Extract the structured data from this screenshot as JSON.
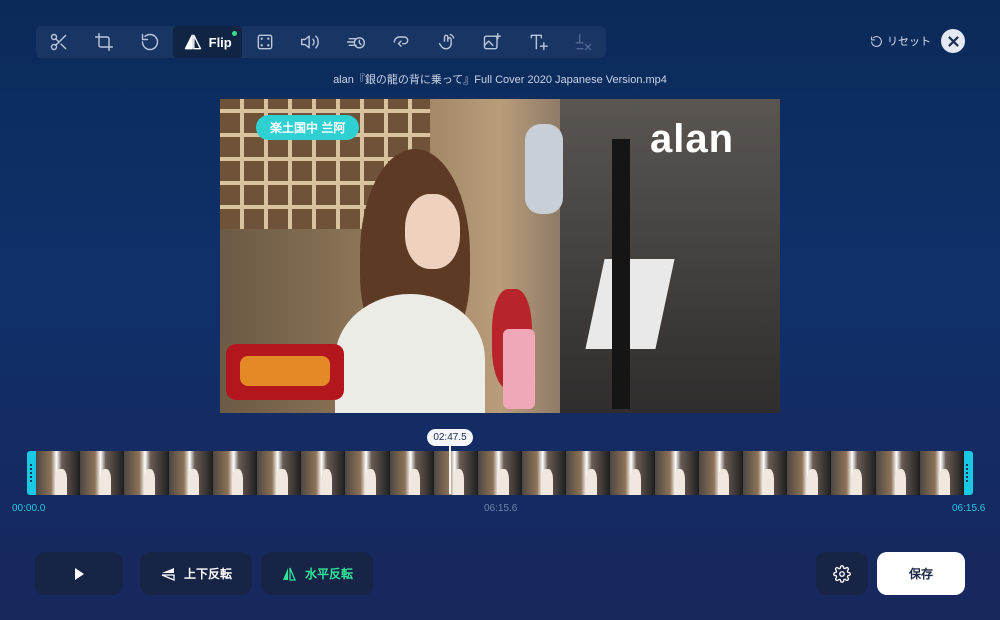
{
  "toolbar": {
    "flip_label": "Flip",
    "tools": [
      {
        "icon": "scissors-icon"
      },
      {
        "icon": "crop-icon"
      },
      {
        "icon": "rotate-icon"
      },
      {
        "icon": "flip-icon",
        "label": "Flip",
        "active": true
      },
      {
        "icon": "frame-icon"
      },
      {
        "icon": "volume-icon"
      },
      {
        "icon": "speed-icon"
      },
      {
        "icon": "loop-icon"
      },
      {
        "icon": "touch-rotate-icon"
      },
      {
        "icon": "add-image-icon"
      },
      {
        "icon": "add-text-icon"
      },
      {
        "icon": "remove-text-icon",
        "disabled": true
      }
    ]
  },
  "header": {
    "reset_label": "リセット",
    "file_name": "alan『銀の龍の背に乗って』Full Cover 2020 Japanese Version.mp4"
  },
  "video": {
    "overlay_logo_text": "alan",
    "channel_tag": "楽土国中 兰阿"
  },
  "timeline": {
    "current_time": "02:47.5",
    "start_time": "00:00.0",
    "mid_time": "06:15.6",
    "end_time": "06:15.6",
    "frame_count": 21
  },
  "controls": {
    "vertical_flip_label": "上下反転",
    "horizontal_flip_label": "水平反転",
    "save_label": "保存"
  },
  "colors": {
    "accent_cyan": "#19c9e4",
    "accent_green": "#2fe49a",
    "background_top": "#0b2a59",
    "background_bottom": "#17275c"
  }
}
